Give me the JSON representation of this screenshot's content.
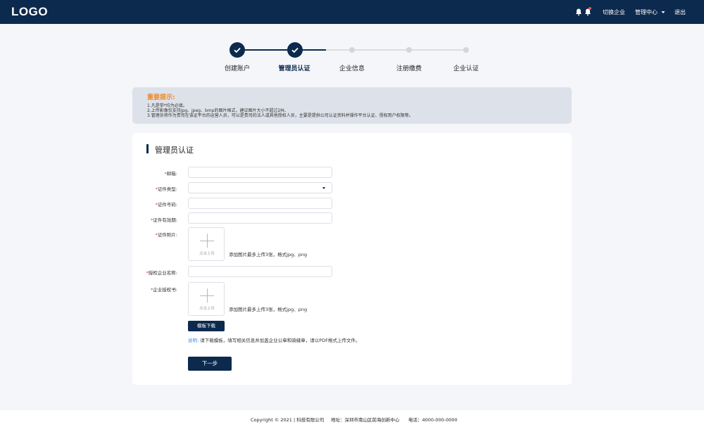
{
  "header": {
    "logo": "LOGO",
    "switch_company": "切换企业",
    "admin_center": "管理中心",
    "logout": "退出"
  },
  "steps": [
    {
      "label": "创建账户",
      "status": "done"
    },
    {
      "label": "管理员认证",
      "status": "current"
    },
    {
      "label": "企业信息",
      "status": "pending"
    },
    {
      "label": "注册缴费",
      "status": "pending"
    },
    {
      "label": "企业认证",
      "status": "pending"
    }
  ],
  "notice": {
    "title": "重要提示:",
    "lines": [
      "1.凡是带*均为必填。",
      "2.上传影像仅支持jpg、jpeg、bmp的图片格式，建议图片大小不超过2M。",
      "3.管理员将作为贵司在该证平台的运营人员，可以是贵司的法人或其他授权人员，主要是提供公司认证资料并操作平台认证、授权用户权限等。"
    ]
  },
  "form": {
    "title": "管理员认证",
    "required_mark": "*",
    "email_label": "邮箱:",
    "email_value": "",
    "id_type_label": "证件类型:",
    "id_type_value": "",
    "id_number_label": "证件号码:",
    "id_number_value": "",
    "id_validity_label": "证件有效期:",
    "id_validity_value": "",
    "id_photo_label": "证件照片:",
    "upload_text": "点击上传",
    "upload_hint": "添加图片最多上传3张，格式jpg、png",
    "auth_company_label": "授权企业名称:",
    "auth_company_value": "",
    "auth_letter_label": "企业授权书:",
    "template_button": "模板下载",
    "note_label": "说明:",
    "note_text": "请下载模板，填写相关信息并加盖企业公章和骑缝章，请以PDF格式上传文件。",
    "next_button": "下一步"
  },
  "footer": {
    "copyright": "Copyright © 2021 | 科技有限公司",
    "address": "地址：深圳市南山区前海创新中心",
    "phone": "电话：4000-000-0000"
  },
  "colors": {
    "primary": "#0c2a4d",
    "warning": "#f08a24",
    "required": "#e03b3b",
    "link": "#3a8ee6"
  }
}
